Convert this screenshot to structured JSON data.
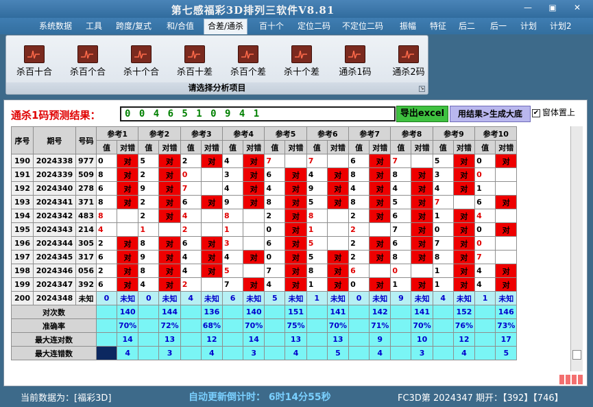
{
  "window": {
    "title": "第七感福彩3D排列三软件V8.81",
    "min": "—",
    "max": "▣",
    "close": "✕"
  },
  "menu": [
    "系统数据",
    "工具",
    "跨度/复式",
    "和/合值",
    "合差/通杀",
    "百十个",
    "定位二码",
    "不定位二码",
    "振幅",
    "特征",
    "后二",
    "后一",
    "计划",
    "计划2"
  ],
  "menu_active": 4,
  "ribbon": {
    "buttons": [
      "杀百十合",
      "杀百个合",
      "杀十个合",
      "杀百十差",
      "杀百个差",
      "杀十个差",
      "通杀1码",
      "通杀2码"
    ],
    "footer": "请选择分析项目",
    "corner": "↘"
  },
  "predict": {
    "title": "通杀1码预测结果：",
    "value": "0 0 4 6 5 1 0 9 4 1"
  },
  "buttons": {
    "excel": "导出excel",
    "gen": "用结果>生成大底"
  },
  "checkbox": {
    "label": "窗体置上",
    "checked": "✔"
  },
  "table": {
    "col_seq": "序号",
    "col_period": "期号",
    "col_num": "号码",
    "col_ref": [
      "参考1",
      "参考2",
      "参考3",
      "参考4",
      "参考5",
      "参考6",
      "参考7",
      "参考8",
      "参考9",
      "参考10"
    ],
    "sub_val": "值",
    "sub_res": "对错",
    "hit_text": "对",
    "unknown_text": "未知",
    "rows": [
      {
        "seq": "190",
        "period": "2024338",
        "num": "977",
        "v": [
          "0",
          "5",
          "2",
          "4",
          "7",
          "7",
          "6",
          "7",
          "5",
          "0"
        ],
        "h": [
          1,
          1,
          1,
          1,
          0,
          0,
          1,
          0,
          1,
          1
        ],
        "red": [
          0,
          0,
          0,
          0,
          1,
          1,
          0,
          1,
          0,
          0
        ]
      },
      {
        "seq": "191",
        "period": "2024339",
        "num": "509",
        "v": [
          "8",
          "2",
          "0",
          "3",
          "6",
          "4",
          "8",
          "8",
          "3",
          "0"
        ],
        "h": [
          1,
          1,
          0,
          1,
          1,
          1,
          1,
          1,
          1,
          0
        ],
        "red": [
          0,
          0,
          1,
          0,
          0,
          0,
          0,
          0,
          0,
          1
        ]
      },
      {
        "seq": "192",
        "period": "2024340",
        "num": "278",
        "v": [
          "6",
          "9",
          "7",
          "4",
          "4",
          "9",
          "4",
          "4",
          "4",
          "1"
        ],
        "h": [
          1,
          1,
          0,
          1,
          1,
          1,
          1,
          1,
          1,
          0
        ],
        "red": [
          0,
          0,
          1,
          0,
          0,
          0,
          0,
          0,
          0,
          0
        ]
      },
      {
        "seq": "193",
        "period": "2024341",
        "num": "371",
        "v": [
          "8",
          "2",
          "6",
          "9",
          "8",
          "5",
          "8",
          "5",
          "7",
          "6"
        ],
        "h": [
          1,
          1,
          1,
          1,
          1,
          1,
          1,
          1,
          0,
          1
        ],
        "red": [
          0,
          0,
          0,
          0,
          0,
          0,
          0,
          0,
          1,
          0
        ]
      },
      {
        "seq": "194",
        "period": "2024342",
        "num": "483",
        "v": [
          "8",
          "2",
          "4",
          "8",
          "2",
          "8",
          "2",
          "6",
          "1",
          "4"
        ],
        "h": [
          0,
          1,
          0,
          0,
          1,
          0,
          1,
          1,
          1,
          0
        ],
        "red": [
          1,
          0,
          1,
          1,
          0,
          1,
          0,
          0,
          0,
          1
        ]
      },
      {
        "seq": "195",
        "period": "2024343",
        "num": "214",
        "v": [
          "4",
          "1",
          "2",
          "1",
          "0",
          "1",
          "2",
          "7",
          "0",
          "0"
        ],
        "h": [
          0,
          0,
          0,
          0,
          1,
          0,
          0,
          1,
          1,
          1
        ],
        "red": [
          1,
          1,
          1,
          1,
          0,
          1,
          1,
          0,
          0,
          0
        ]
      },
      {
        "seq": "196",
        "period": "2024344",
        "num": "305",
        "v": [
          "2",
          "8",
          "6",
          "3",
          "6",
          "5",
          "2",
          "6",
          "7",
          "0"
        ],
        "h": [
          1,
          1,
          1,
          0,
          1,
          0,
          1,
          1,
          1,
          0
        ],
        "red": [
          0,
          0,
          0,
          1,
          0,
          1,
          0,
          0,
          0,
          1
        ]
      },
      {
        "seq": "197",
        "period": "2024345",
        "num": "317",
        "v": [
          "6",
          "9",
          "4",
          "4",
          "0",
          "5",
          "2",
          "8",
          "8",
          "7"
        ],
        "h": [
          1,
          1,
          1,
          1,
          1,
          1,
          1,
          1,
          1,
          0
        ],
        "red": [
          0,
          0,
          0,
          0,
          0,
          0,
          0,
          0,
          0,
          1
        ]
      },
      {
        "seq": "198",
        "period": "2024346",
        "num": "056",
        "v": [
          "2",
          "8",
          "4",
          "5",
          "7",
          "8",
          "6",
          "0",
          "1",
          "4"
        ],
        "h": [
          1,
          1,
          1,
          0,
          1,
          1,
          0,
          0,
          1,
          1
        ],
        "red": [
          0,
          0,
          0,
          1,
          0,
          0,
          1,
          1,
          0,
          0
        ]
      },
      {
        "seq": "199",
        "period": "2024347",
        "num": "392",
        "v": [
          "6",
          "4",
          "2",
          "7",
          "4",
          "1",
          "0",
          "1",
          "1",
          "4"
        ],
        "h": [
          1,
          1,
          0,
          1,
          1,
          1,
          1,
          1,
          1,
          1
        ],
        "red": [
          0,
          0,
          1,
          0,
          0,
          0,
          0,
          0,
          0,
          0
        ]
      }
    ],
    "next": {
      "seq": "200",
      "period": "2024348",
      "num": "未知",
      "v": [
        "0",
        "0",
        "4",
        "6",
        "5",
        "1",
        "0",
        "9",
        "4",
        "1"
      ]
    },
    "stats": [
      {
        "label": "对次数",
        "vals": [
          "140",
          "144",
          "136",
          "140",
          "151",
          "141",
          "142",
          "141",
          "152",
          "146"
        ]
      },
      {
        "label": "准确率",
        "vals": [
          "70%",
          "72%",
          "68%",
          "70%",
          "75%",
          "70%",
          "71%",
          "70%",
          "76%",
          "73%"
        ]
      },
      {
        "label": "最大连对数",
        "vals": [
          "14",
          "13",
          "12",
          "14",
          "13",
          "13",
          "9",
          "10",
          "12",
          "17"
        ]
      },
      {
        "label": "最大连错数",
        "vals": [
          "4",
          "3",
          "4",
          "3",
          "4",
          "5",
          "4",
          "3",
          "4",
          "5"
        ]
      }
    ]
  },
  "status": {
    "current": "当前数据为：[福彩3D]",
    "countdown": "自动更新倒计时： 6时14分55秒",
    "draw": "FC3D第 2024347 期开：【392】【746】"
  }
}
